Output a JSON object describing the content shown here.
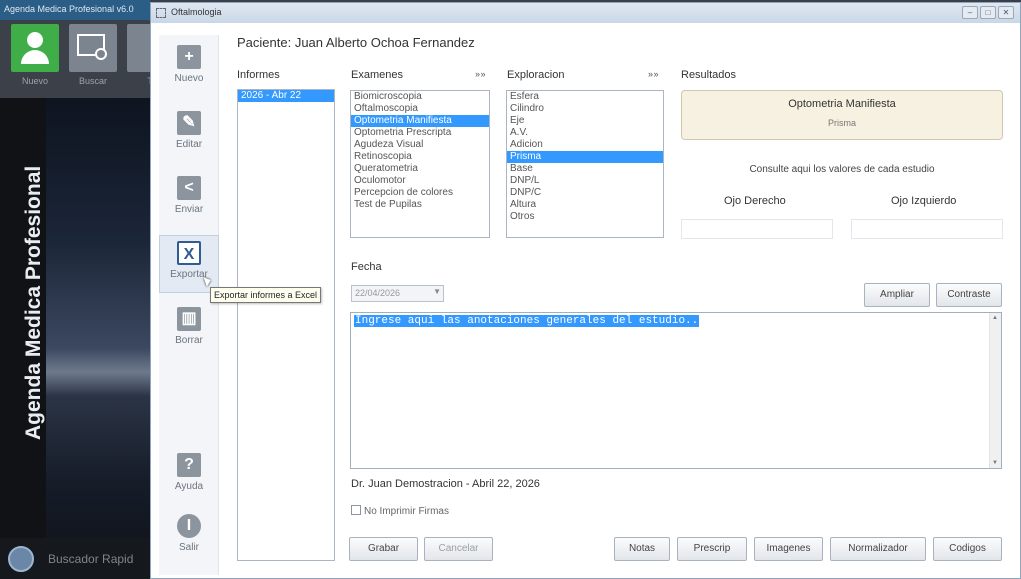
{
  "background_app": {
    "title": "Agenda Medica Profesional v6.0",
    "toolbar": [
      {
        "label": "Nuevo",
        "color": "#3fae49"
      },
      {
        "label": "Buscar",
        "color": "#7c858f"
      },
      {
        "label": "Ti",
        "color": "#7c858f"
      }
    ],
    "vertical_title": "Agenda Medica Profesional",
    "search_label": "Buscador Rapid"
  },
  "window": {
    "title": "Oftalmologia",
    "controls": {
      "minimize": "–",
      "maximize": "□",
      "close": "✕"
    }
  },
  "actions": [
    {
      "label": "Nuevo",
      "icon": "+"
    },
    {
      "label": "Editar",
      "icon": "✎"
    },
    {
      "label": "Enviar",
      "icon": "<"
    },
    {
      "label": "Exportar",
      "icon": "X"
    },
    {
      "label": "Borrar",
      "icon": "▥"
    },
    {
      "label": "Ayuda",
      "icon": "?"
    },
    {
      "label": "Salir",
      "icon": "I"
    }
  ],
  "tooltip": "Exportar informes a Excel",
  "patient": "Paciente: Juan Alberto Ochoa Fernandez",
  "informes": {
    "label": "Informes",
    "items": [
      "2026 - Abr 22"
    ],
    "selected": 0
  },
  "examenes": {
    "label": "Examenes",
    "arrows": "» »",
    "items": [
      "Biomicroscopia",
      "Oftalmoscopia",
      "Optometria Manifiesta",
      "Optometria Prescripta",
      "Agudeza Visual",
      "Retinoscopia",
      "Queratometria",
      "Oculomotor",
      "Percepcion de colores",
      "Test de Pupilas"
    ],
    "selected": 2
  },
  "exploracion": {
    "label": "Exploracion",
    "arrows": "» »",
    "items": [
      "Esfera",
      "Cilindro",
      "Eje",
      "A.V.",
      "Adicion",
      "Prisma",
      "Base",
      "DNP/L",
      "DNP/C",
      "Altura",
      "Otros"
    ],
    "selected": 5
  },
  "resultados": {
    "label": "Resultados",
    "card_title": "Optometria Manifiesta",
    "card_subtitle": "Prisma",
    "hint": "Consulte aqui los valores de cada estudio",
    "ojo_derecho": "Ojo Derecho",
    "ojo_izquierdo": "Ojo Izquierdo"
  },
  "fecha": {
    "label": "Fecha",
    "value": "22/04/2026"
  },
  "buttons": {
    "ampliar": "Ampliar",
    "contraste": "Contraste",
    "grabar": "Grabar",
    "cancelar": "Cancelar",
    "notas": "Notas",
    "prescrip": "Prescrip",
    "imagenes": "Imagenes",
    "normalizador": "Normalizador",
    "codigos": "Codigos"
  },
  "notes_text": "Ingrese aqui las anotaciones generales del estudio..",
  "doctor": "Dr. Juan Demostracion - Abril 22, 2026",
  "no_imprimir": "No Imprimir Firmas"
}
